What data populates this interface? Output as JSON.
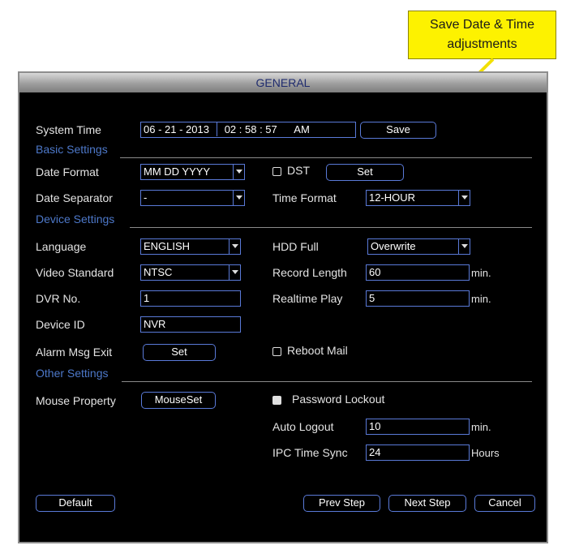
{
  "callout": {
    "line1": "Save Date & Time",
    "line2": "adjustments"
  },
  "window": {
    "title": "GENERAL"
  },
  "system_time": {
    "label": "System Time",
    "date": "06 - 21 - 2013",
    "time": "02 : 58 : 57",
    "ampm": "AM",
    "save_label": "Save"
  },
  "basic_settings": {
    "heading": "Basic Settings",
    "date_format": {
      "label": "Date Format",
      "value": "MM DD YYYY"
    },
    "dst": {
      "label": "DST",
      "set_label": "Set",
      "checked": false
    },
    "date_separator": {
      "label": "Date Separator",
      "value": "-"
    },
    "time_format": {
      "label": "Time Format",
      "value": "12-HOUR"
    }
  },
  "device_settings": {
    "heading": "Device Settings",
    "language": {
      "label": "Language",
      "value": "ENGLISH"
    },
    "hdd_full": {
      "label": "HDD Full",
      "value": "Overwrite"
    },
    "video_standard": {
      "label": "Video Standard",
      "value": "NTSC"
    },
    "record_length": {
      "label": "Record Length",
      "value": "60",
      "unit": "min."
    },
    "dvr_no": {
      "label": "DVR No.",
      "value": "1"
    },
    "realtime_play": {
      "label": "Realtime Play",
      "value": "5",
      "unit": "min."
    },
    "device_id": {
      "label": "Device ID",
      "value": "NVR"
    },
    "alarm_msg_exit": {
      "label": "Alarm Msg Exit",
      "set_label": "Set"
    },
    "reboot_mail": {
      "label": "Reboot Mail",
      "checked": false
    }
  },
  "other_settings": {
    "heading": "Other Settings",
    "mouse_property": {
      "label": "Mouse Property",
      "button_label": "MouseSet"
    },
    "password_lockout": {
      "label": "Password Lockout",
      "checked": true
    },
    "auto_logout": {
      "label": "Auto Logout",
      "value": "10",
      "unit": "min."
    },
    "ipc_time_sync": {
      "label": "IPC Time Sync",
      "value": "24",
      "unit": "Hours"
    }
  },
  "footer": {
    "default_label": "Default",
    "prev_label": "Prev Step",
    "next_label": "Next Step",
    "cancel_label": "Cancel"
  },
  "colors": {
    "window_bg": "#000000",
    "border_accent": "#5a7ad8",
    "section_heading": "#4d78c9",
    "callout_bg": "#fdf200",
    "arrow": "#f2e000"
  }
}
